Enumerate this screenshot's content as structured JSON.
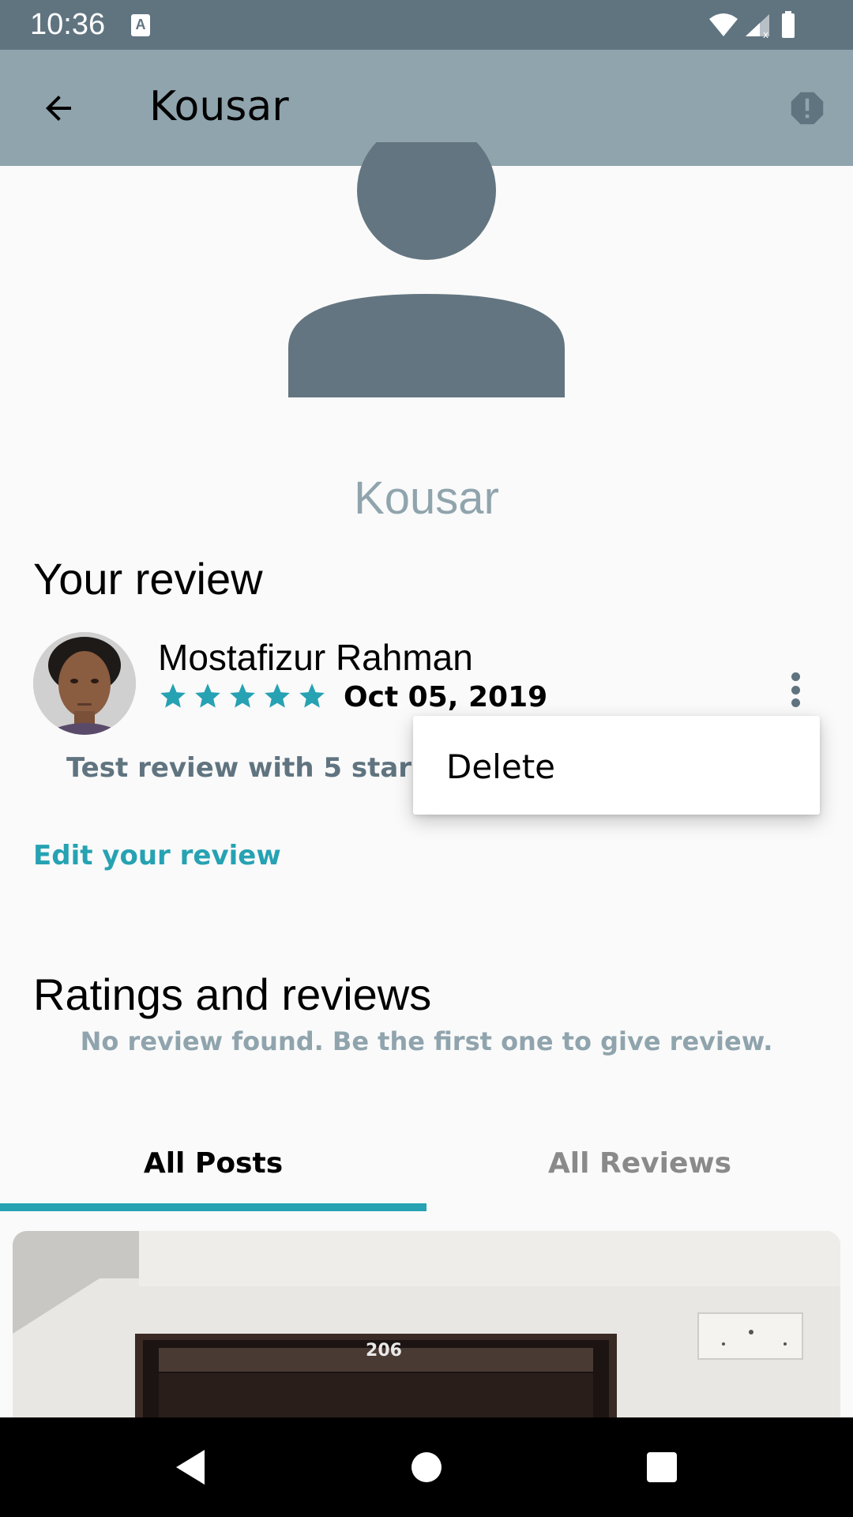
{
  "status_bar": {
    "time": "10:36",
    "keyboard_indicator": "A"
  },
  "app_bar": {
    "title": "Kousar",
    "back_icon": "arrow-back-icon",
    "report_icon": "report-icon"
  },
  "profile": {
    "name": "Kousar",
    "avatar_icon": "person-placeholder-icon"
  },
  "your_review": {
    "title": "Your review",
    "reviewer_name": "Mostafizur Rahman",
    "rating": 5,
    "rating_max": 5,
    "date": "Oct 05, 2019",
    "text": "Test review with 5 star :)",
    "edit_label": "Edit your review"
  },
  "popup_menu": {
    "items": [
      {
        "label": "Delete"
      }
    ]
  },
  "ratings": {
    "title": "Ratings and reviews",
    "empty_message": "No review found. Be the first one to give review."
  },
  "tabs": [
    {
      "label": "All Posts",
      "selected": true
    },
    {
      "label": "All Reviews",
      "selected": false
    }
  ],
  "post": {
    "image_label": "206"
  },
  "colors": {
    "status_bar": "#607480",
    "app_bar": "#90a4ad",
    "accent": "#26a2b3",
    "avatar": "#637580"
  }
}
